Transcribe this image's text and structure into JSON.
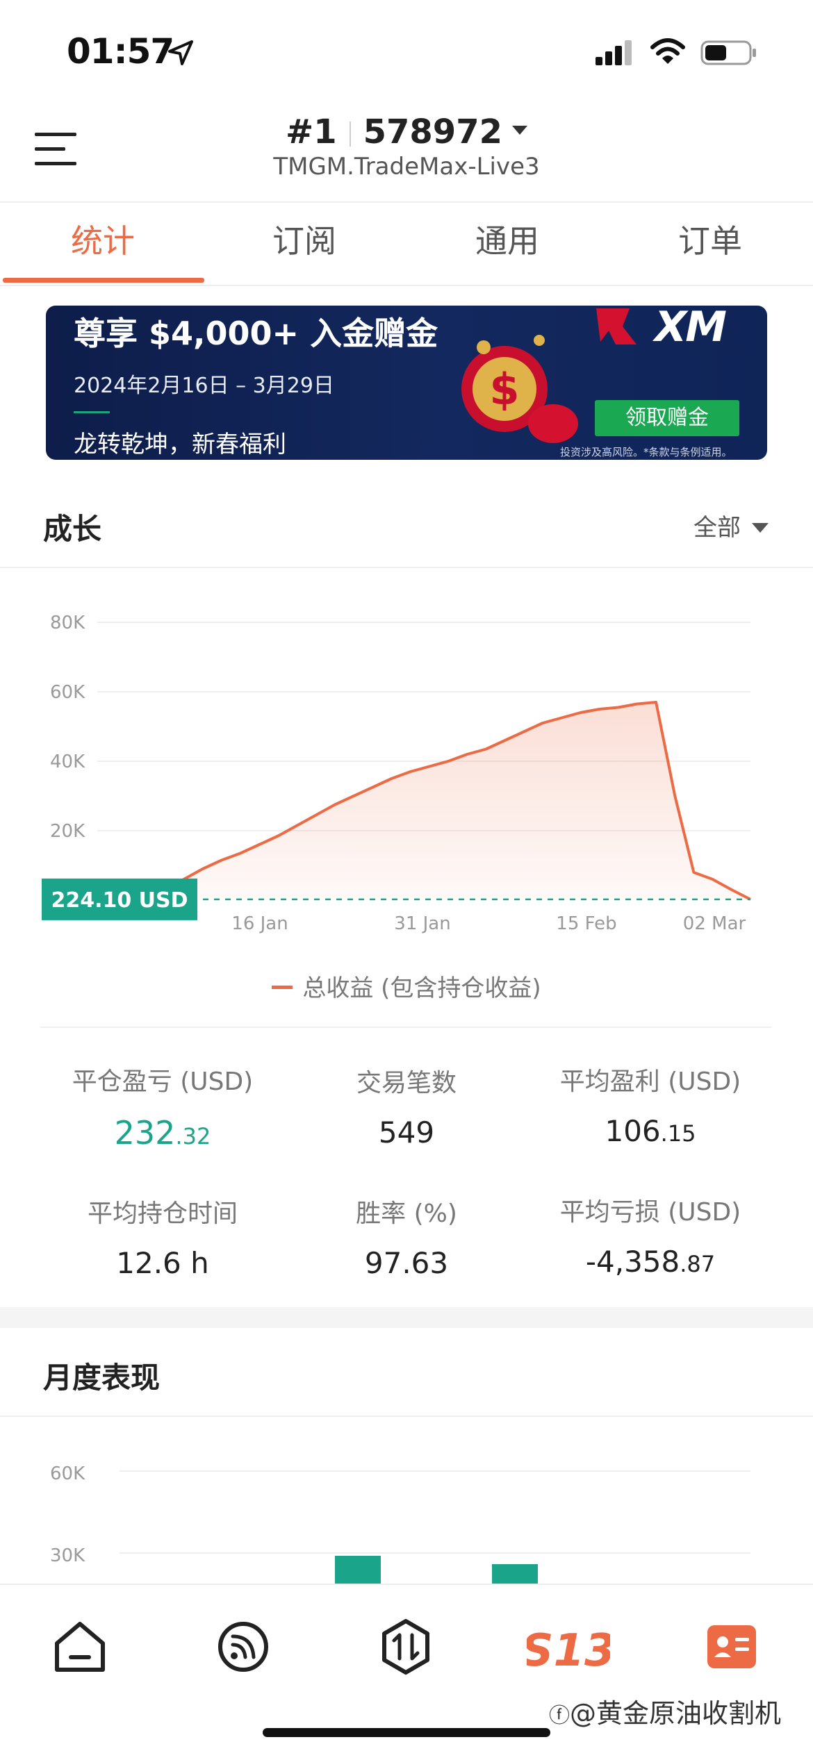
{
  "status_bar": {
    "time": "01:57",
    "icons": [
      "location-arrow-icon",
      "cellular-signal-icon",
      "wifi-icon",
      "battery-icon"
    ]
  },
  "header": {
    "account_index": "#1",
    "account_number": "578972",
    "server": "TMGM.TradeMax-Live3",
    "menu_icon": "hamburger-menu-icon"
  },
  "tabs": [
    {
      "label": "统计",
      "active": true
    },
    {
      "label": "订阅",
      "active": false
    },
    {
      "label": "通用",
      "active": false
    },
    {
      "label": "订单",
      "active": false
    }
  ],
  "banner": {
    "title": "尊享 $4,000+ 入金赠金",
    "date_range": "2024年2月16日 – 3月29日",
    "subtitle": "龙转乾坤，新春福利",
    "brand": "XM",
    "button_label": "领取赠金",
    "disclaimer": "投资涉及高风险。*条款与条例适用。"
  },
  "growth": {
    "title": "成长",
    "range_label": "全部",
    "legend_label": "总收益 (包含持仓收益)",
    "current_value_label": "224.10 USD"
  },
  "colors": {
    "accent": "#ec6b45",
    "positive": "#1aa58a",
    "banner_bg": "#13285e",
    "banner_button": "#1aa853"
  },
  "chart_data": {
    "type": "area",
    "y_tick_labels": [
      "80K",
      "60K",
      "40K",
      "20K"
    ],
    "x_tick_labels": [
      "16 Jan",
      "31 Jan",
      "15 Feb",
      "02 Mar"
    ],
    "ylim": [
      0,
      80000
    ],
    "grid": true,
    "series": [
      {
        "name": "总收益 (包含持仓收益)",
        "x": [
          "06 Jan",
          "08 Jan",
          "10 Jan",
          "12 Jan",
          "14 Jan",
          "16 Jan",
          "18 Jan",
          "20 Jan",
          "22 Jan",
          "24 Jan",
          "26 Jan",
          "28 Jan",
          "30 Jan",
          "01 Feb",
          "03 Feb",
          "05 Feb",
          "07 Feb",
          "09 Feb",
          "11 Feb",
          "13 Feb",
          "15 Feb",
          "17 Feb",
          "19 Feb",
          "21 Feb",
          "23 Feb",
          "25 Feb",
          "27 Feb",
          "29 Feb",
          "01 Mar",
          "02 Mar",
          "03 Mar",
          "04 Mar",
          "05 Mar"
        ],
        "values": [
          224,
          3000,
          6000,
          9000,
          11500,
          13500,
          16000,
          18500,
          21500,
          24500,
          27500,
          30000,
          32500,
          35000,
          37000,
          38500,
          40000,
          42000,
          43500,
          46000,
          48500,
          51000,
          52500,
          54000,
          55000,
          55500,
          56500,
          57000,
          30000,
          8000,
          6000,
          3000,
          224
        ]
      }
    ]
  },
  "stats": [
    {
      "label": "平仓盈亏 (USD)",
      "value_int": "232",
      "value_dec": ".32",
      "green": true
    },
    {
      "label": "交易笔数",
      "value_int": "549",
      "value_dec": "",
      "green": false
    },
    {
      "label": "平均盈利 (USD)",
      "value_int": "106",
      "value_dec": ".15",
      "green": false
    },
    {
      "label": "平均持仓时间",
      "value_int": "12.6 h",
      "value_dec": "",
      "green": false
    },
    {
      "label": "胜率 (%)",
      "value_int": "97.63",
      "value_dec": "",
      "green": false
    },
    {
      "label": "平均亏损 (USD)",
      "value_int": "-4,358",
      "value_dec": ".87",
      "green": false
    }
  ],
  "monthly": {
    "title": "月度表现",
    "y_tick_labels": [
      "60K",
      "30K"
    ]
  },
  "bottom_nav": {
    "items": [
      "home-icon",
      "signal-feed-icon",
      "trade-icon",
      "s13-logo-icon",
      "profile-card-icon"
    ],
    "active": "s13-logo-icon"
  },
  "watermark": "@黄金原油收割机"
}
